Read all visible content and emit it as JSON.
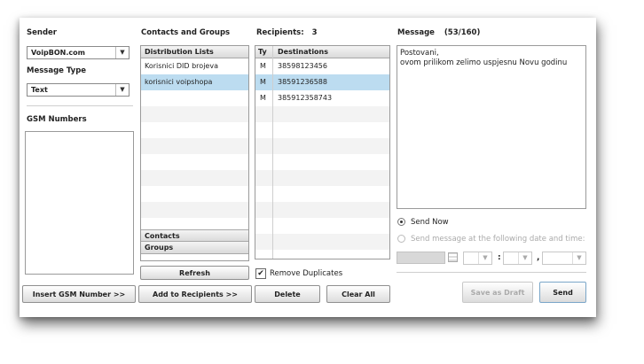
{
  "sender": {
    "label": "Sender",
    "value": "VoipBON.com"
  },
  "message_type": {
    "label": "Message Type",
    "value": "Text"
  },
  "gsm_numbers": {
    "label": "GSM Numbers",
    "insert_button": "Insert GSM Number >>"
  },
  "contacts": {
    "label": "Contacts and Groups",
    "distribution_lists_label": "Distribution Lists",
    "lists": [
      "Korisnici DID brojeva",
      "korisnici voipshopa"
    ],
    "selected_index": 1,
    "contacts_tab": "Contacts",
    "groups_tab": "Groups",
    "refresh_button": "Refresh",
    "add_button": "Add to Recipients >>"
  },
  "recipients": {
    "label": "Recipients:",
    "count": "3",
    "col_type": "Ty",
    "col_destinations": "Destinations",
    "rows": [
      {
        "type": "M",
        "destination": "38598123456"
      },
      {
        "type": "M",
        "destination": "38591236588"
      },
      {
        "type": "M",
        "destination": "385912358743"
      }
    ],
    "selected_index": 1,
    "remove_duplicates_label": "Remove Duplicates",
    "remove_duplicates_checked": true,
    "delete_button": "Delete",
    "clear_button": "Clear All"
  },
  "message": {
    "label": "Message",
    "counter": "(53/160)",
    "text_line1": "Postovani,",
    "text_line2": "ovom prilikom zelimo uspjesnu Novu godinu",
    "send_now_label": "Send Now",
    "schedule_label": "Send message at the following date and time:",
    "save_draft_button": "Save as Draft",
    "send_button": "Send",
    "time_separator_1": ":",
    "time_separator_2": ","
  },
  "colors": {
    "selection": "#bcdcf0",
    "panel_border": "#9a9a9a"
  }
}
